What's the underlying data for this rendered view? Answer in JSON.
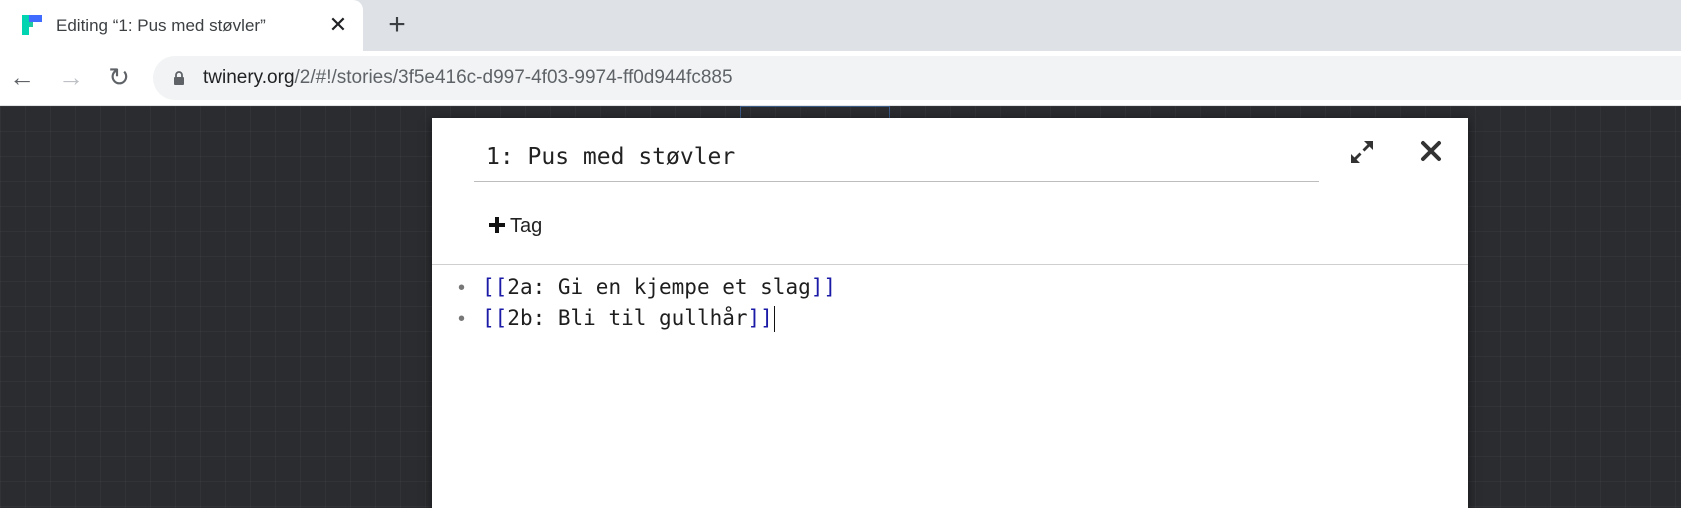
{
  "browser": {
    "tab": {
      "title": "Editing “1: Pus med støvler”",
      "close_glyph": "✕",
      "favicon_colors": {
        "left": "#00d4b1",
        "right": "#3f6bff"
      }
    },
    "new_tab_glyph": "+",
    "nav": {
      "back_glyph": "←",
      "forward_glyph": "→",
      "reload_glyph": "↻"
    },
    "url": {
      "host": "twinery.org",
      "path": "/2/#!/stories/3f5e416c-d997-4f03-9974-ff0d944fc885"
    }
  },
  "dialog": {
    "passage_name": "1: Pus med støvler",
    "maximize_icon": "expand-icon",
    "close_icon": "close-icon",
    "tag_button_label": "Tag",
    "editor": {
      "bullet": "•",
      "lines": [
        {
          "open": "[[",
          "text": "2a: Gi en kjempe et slag",
          "close": "]]"
        },
        {
          "open": "[[",
          "text": "2b: Bli til gullhår",
          "close": "]]"
        }
      ]
    }
  },
  "colors": {
    "workspace_bg": "#2a2c30",
    "link_bracket": "#1a1aa6",
    "tabstrip_bg": "#dee1e6"
  }
}
